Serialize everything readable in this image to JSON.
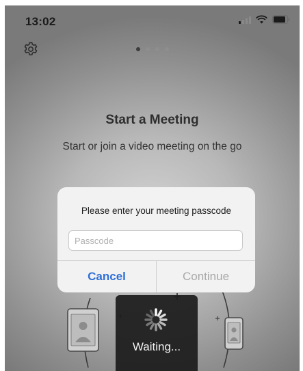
{
  "status_bar": {
    "time": "13:02",
    "icons": [
      "cellular-signal-icon",
      "wifi-icon",
      "battery-icon"
    ]
  },
  "header": {
    "settings_icon": "gear-icon",
    "page_indicator": {
      "total": 4,
      "current": 1
    }
  },
  "main": {
    "title": "Start a Meeting",
    "subtitle": "Start or join a video meeting on the go"
  },
  "dialog": {
    "message": "Please enter your meeting passcode",
    "passcode_placeholder": "Passcode",
    "passcode_value": "",
    "cancel_label": "Cancel",
    "continue_label": "Continue"
  },
  "hud": {
    "label": "Waiting..."
  },
  "colors": {
    "accent_blue": "#2f6fd6",
    "disabled_gray": "#a8a8a8",
    "hud_background": "#1c1c1c"
  }
}
